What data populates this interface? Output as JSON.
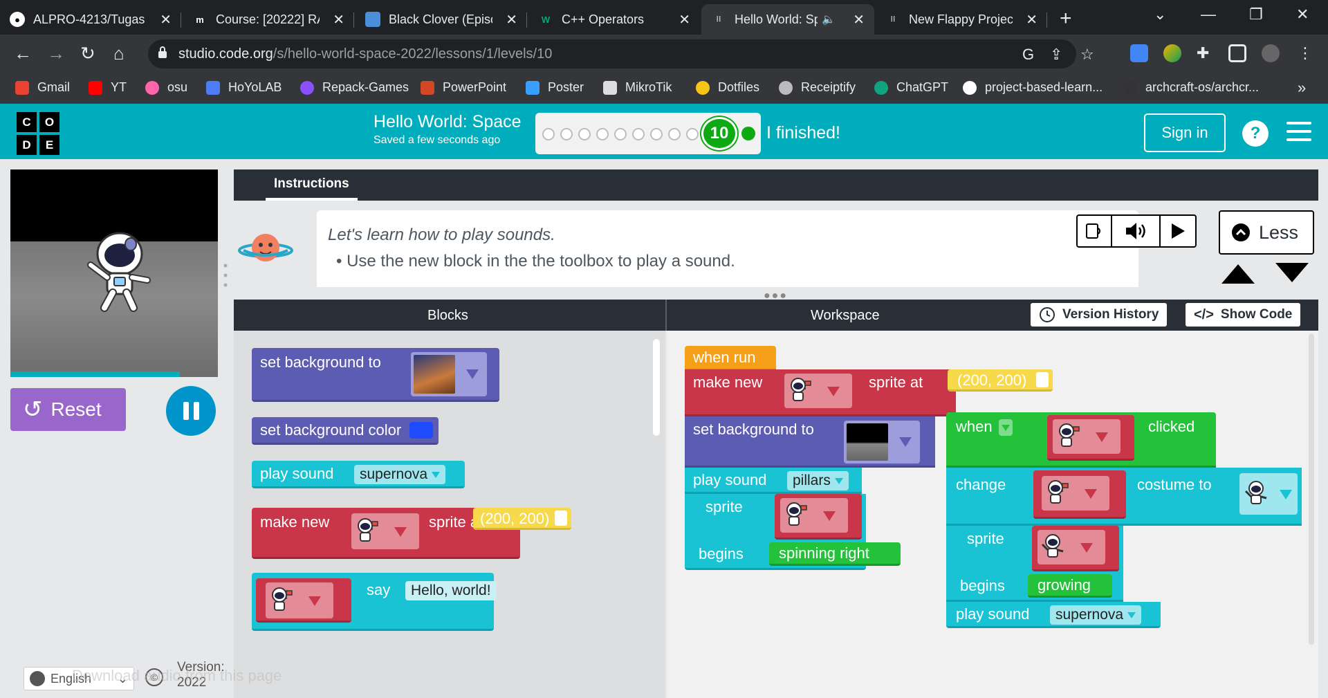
{
  "browser": {
    "tabs": [
      {
        "title": "ALPRO-4213/Tugas",
        "icon": "github-icon",
        "color": "#ffffff"
      },
      {
        "title": "Course: [20222] RA",
        "icon": "moodle-icon",
        "color": "#ffffff"
      },
      {
        "title": "Black Clover (Episo",
        "icon": "page-icon",
        "color": "#4a90d9"
      },
      {
        "title": "C++ Operators",
        "icon": "w3schools-icon",
        "color": "#04aa6d"
      },
      {
        "title": "Hello World: Sp",
        "icon": "code-org-icon",
        "color": "#ffffff"
      },
      {
        "title": "New Flappy Project",
        "icon": "code-org-icon",
        "color": "#ffffff"
      }
    ],
    "url_host": "studio.code.org",
    "url_path": "/s/hello-world-space-2022/lessons/1/levels/10",
    "bookmarks": [
      {
        "label": "Gmail",
        "color": "#ea4335"
      },
      {
        "label": "YT",
        "color": "#ff0000"
      },
      {
        "label": "osu",
        "color": "#ff66aa"
      },
      {
        "label": "HoYoLAB",
        "color": "#4e7cf6"
      },
      {
        "label": "Repack-Games",
        "color": "#8a4fff"
      },
      {
        "label": "PowerPoint",
        "color": "#d24726"
      },
      {
        "label": "Poster",
        "color": "#3aa0ff"
      },
      {
        "label": "MikroTik",
        "color": "#dddddd"
      },
      {
        "label": "Dotfiles",
        "color": "#f5c518"
      },
      {
        "label": "Receiptify",
        "color": "#bbbbbb"
      },
      {
        "label": "ChatGPT",
        "color": "#10a37f"
      },
      {
        "label": "project-based-learn...",
        "color": "#ffffff"
      },
      {
        "label": "archcraft-os/archcr...",
        "color": "#333333"
      }
    ]
  },
  "header": {
    "logo_letters": [
      "C",
      "O",
      "D",
      "E"
    ],
    "title": "Hello World: Space",
    "subtitle": "Saved a few seconds ago",
    "level": "10",
    "finished_label": "I finished!",
    "signin_label": "Sign in",
    "help_label": "?",
    "accent": "#00adbc"
  },
  "stage": {
    "reset_label": "Reset"
  },
  "instructions": {
    "tab_label": "Instructions",
    "line1": "Let's learn how to play sounds.",
    "line2": "Use the new block in the the toolbox to play a sound.",
    "less_label": "Less"
  },
  "panels": {
    "blocks_label": "Blocks",
    "workspace_label": "Workspace",
    "version_history_label": "Version History",
    "show_code_label": "Show Code"
  },
  "toolbox_blocks": {
    "set_background": "set background to",
    "set_background_color": "set background color",
    "play_sound": "play sound",
    "play_sound_value": "supernova",
    "make_new": "make new",
    "sprite_at": "sprite at",
    "coords": "(200, 200)",
    "say": "say",
    "say_value": "Hello, world!"
  },
  "workspace_blocks": {
    "when_run": "when run",
    "make_new": "make new",
    "sprite_at": "sprite at",
    "coords": "(200, 200)",
    "set_background": "set background to",
    "play_sound": "play sound",
    "play_sound_value": "pillars",
    "sprite": "sprite",
    "begins": "begins",
    "begins_value": "spinning right",
    "when": "when",
    "clicked": "clicked",
    "change": "change",
    "costume_to": "costume to",
    "sprite2": "sprite",
    "begins2": "begins",
    "begins2_value": "growing",
    "play_sound2": "play sound",
    "play_sound2_value": "supernova"
  },
  "footer": {
    "language": "English",
    "version_label": "Version:",
    "version_value": "2022",
    "download_audio": "Download audio from this page"
  }
}
